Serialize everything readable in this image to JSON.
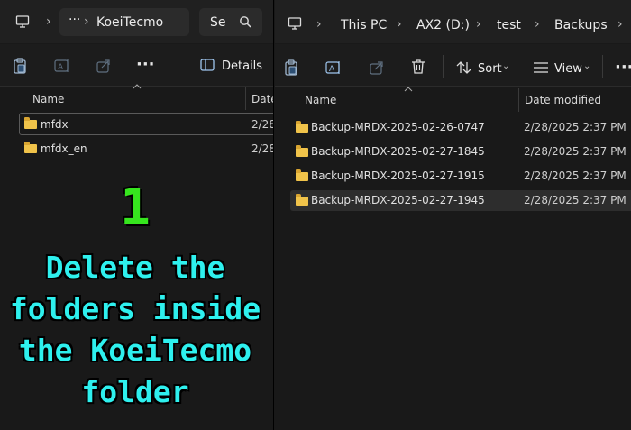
{
  "left": {
    "address": {
      "overflow": "···",
      "crumb": "KoeiTecmo",
      "search_partial": "Se"
    },
    "toolbar": {
      "more": "···",
      "details_label": "Details"
    },
    "columns": {
      "name": "Name",
      "date": "Date"
    },
    "rows": [
      {
        "name": "mfdx",
        "date": "2/28/"
      },
      {
        "name": "mfdx_en",
        "date": "2/28/"
      }
    ]
  },
  "right": {
    "address": {
      "crumbs": [
        "This PC",
        "AX2 (D:)",
        "test",
        "Backups"
      ]
    },
    "toolbar": {
      "sort_label": "Sort",
      "view_label": "View",
      "more": "···"
    },
    "columns": {
      "name": "Name",
      "date_modified": "Date modified"
    },
    "rows": [
      {
        "name": "Backup-MRDX-2025-02-26-0747",
        "date": "2/28/2025 2:37 PM"
      },
      {
        "name": "Backup-MRDX-2025-02-27-1845",
        "date": "2/28/2025 2:37 PM"
      },
      {
        "name": "Backup-MRDX-2025-02-27-1915",
        "date": "2/28/2025 2:37 PM"
      },
      {
        "name": "Backup-MRDX-2025-02-27-1945",
        "date": "2/28/2025 2:37 PM"
      }
    ]
  },
  "overlay": {
    "step_number": "1",
    "lines": [
      "Delete the",
      "folders inside",
      "the KoeiTecmo",
      "folder"
    ]
  },
  "colors": {
    "caption": "#2ef0ee",
    "step_number": "#36e51e",
    "folder": "#f0c34a",
    "background": "#191919"
  }
}
